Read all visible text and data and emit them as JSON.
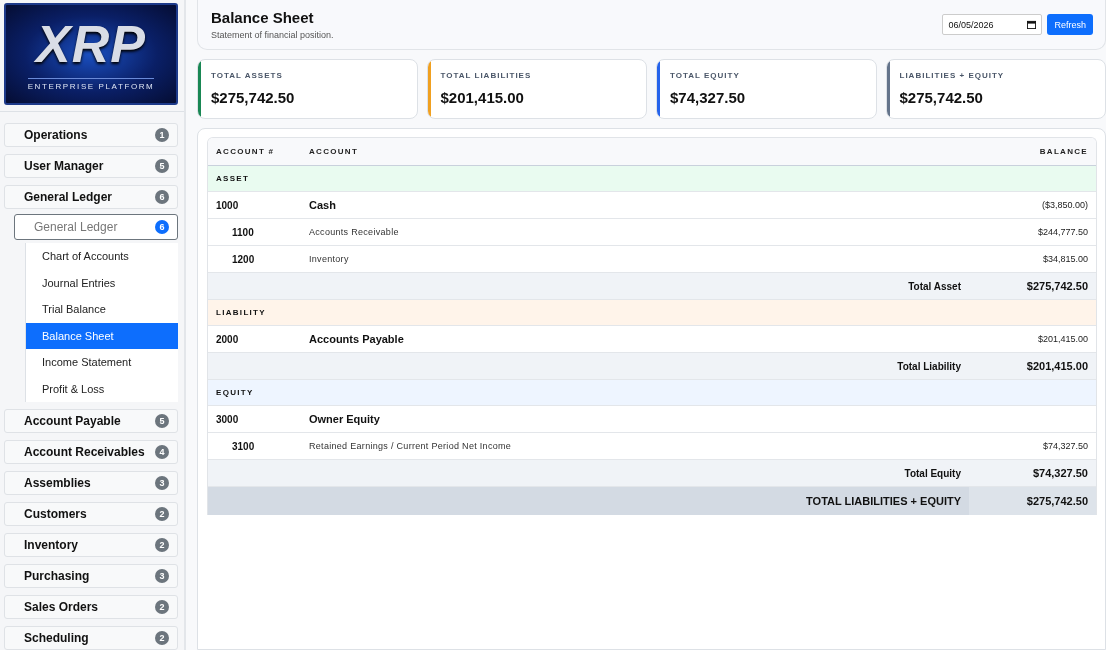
{
  "logo": {
    "title": "XRP",
    "subtitle": "ENTERPRISE PLATFORM"
  },
  "sidebar": {
    "items": [
      {
        "label": "Operations",
        "count": "1"
      },
      {
        "label": "User Manager",
        "count": "5"
      },
      {
        "label": "General Ledger",
        "count": "6",
        "group": {
          "label": "General Ledger",
          "count": "6",
          "children": [
            {
              "label": "Chart of Accounts",
              "selected": false
            },
            {
              "label": "Journal Entries",
              "selected": false
            },
            {
              "label": "Trial Balance",
              "selected": false
            },
            {
              "label": "Balance Sheet",
              "selected": true
            },
            {
              "label": "Income Statement",
              "selected": false
            },
            {
              "label": "Profit & Loss",
              "selected": false
            }
          ]
        }
      },
      {
        "label": "Account Payable",
        "count": "5"
      },
      {
        "label": "Account Receivables",
        "count": "4"
      },
      {
        "label": "Assemblies",
        "count": "3"
      },
      {
        "label": "Customers",
        "count": "2"
      },
      {
        "label": "Inventory",
        "count": "2"
      },
      {
        "label": "Purchasing",
        "count": "3"
      },
      {
        "label": "Sales Orders",
        "count": "2"
      },
      {
        "label": "Scheduling",
        "count": "2"
      }
    ]
  },
  "header": {
    "title": "Balance Sheet",
    "subtitle": "Statement of financial position.",
    "date": "06/05/2026",
    "button": "Refresh"
  },
  "cards": [
    {
      "label": "TOTAL ASSETS",
      "value": "$275,742.50",
      "color": "#198754"
    },
    {
      "label": "TOTAL LIABILITIES",
      "value": "$201,415.00",
      "color": "#f0a020"
    },
    {
      "label": "TOTAL EQUITY",
      "value": "$74,327.50",
      "color": "#2563eb"
    },
    {
      "label": "LIABILITIES + EQUITY",
      "value": "$275,742.50",
      "color": "#64748b"
    }
  ],
  "table": {
    "columns": [
      "ACCOUNT #",
      "ACCOUNT",
      "BALANCE"
    ],
    "rows": [
      {
        "kind": "section",
        "label": "ASSET",
        "color": "#e9fbf0"
      },
      {
        "kind": "account",
        "number": "1000",
        "name": "Cash",
        "balance": "($3,850.00)"
      },
      {
        "kind": "subaccount",
        "number": "1100",
        "name": "Accounts Receivable",
        "balance": "$244,777.50"
      },
      {
        "kind": "subaccount",
        "number": "1200",
        "name": "Inventory",
        "balance": "$34,815.00"
      },
      {
        "kind": "total",
        "label": "Total Asset",
        "balance": "$275,742.50"
      },
      {
        "kind": "section",
        "label": "LIABILITY",
        "color": "#fff4ea"
      },
      {
        "kind": "account",
        "number": "2000",
        "name": "Accounts Payable",
        "balance": "$201,415.00"
      },
      {
        "kind": "total",
        "label": "Total Liability",
        "balance": "$201,415.00"
      },
      {
        "kind": "section",
        "label": "EQUITY",
        "color": "#eef5ff"
      },
      {
        "kind": "account",
        "number": "3000",
        "name": "Owner Equity"
      },
      {
        "kind": "subaccount",
        "number": "3100",
        "name": "Retained Earnings / Current Period Net Income",
        "balance": "$74,327.50"
      },
      {
        "kind": "total",
        "label": "Total Equity",
        "balance": "$74,327.50"
      },
      {
        "kind": "grand_total",
        "label": "TOTAL LIABILITIES + EQUITY",
        "balance": "$275,742.50"
      }
    ]
  }
}
